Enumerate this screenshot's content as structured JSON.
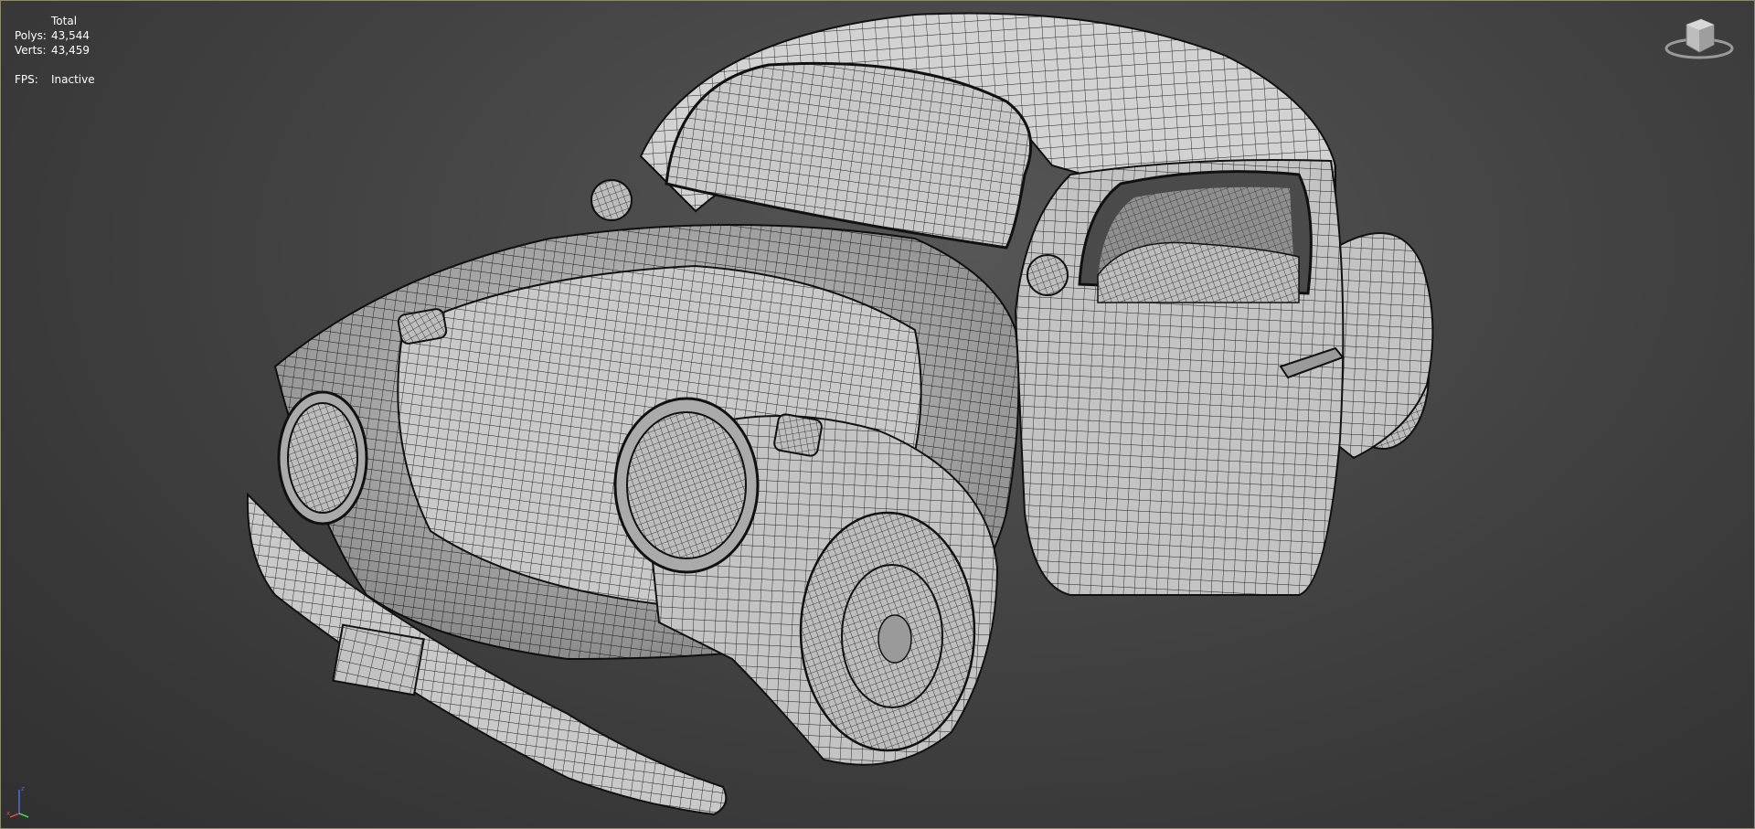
{
  "viewport": {
    "stats": {
      "header": "Total",
      "polys_label": "Polys:",
      "polys_value": "43,544",
      "verts_label": "Verts:",
      "verts_value": "43,459",
      "fps_label": "FPS:",
      "fps_value": "Inactive"
    },
    "viewcube_icon": "viewcube-icon",
    "axis_icon": "axis-tripod-icon",
    "model_icon": "car-wireframe-model",
    "colors": {
      "background": "#474747",
      "mesh_fill": "#c8c8c8",
      "wire": "#1e1e1e"
    }
  }
}
